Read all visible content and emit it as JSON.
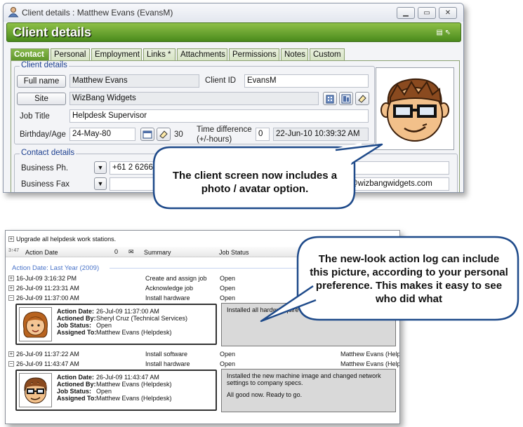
{
  "client_window": {
    "title": "Client details : Matthew Evans  (EvansM)",
    "header_title": "Client details",
    "tabs": [
      "Contact",
      "Personal",
      "Employment",
      "Links *",
      "Attachments",
      "Permissions",
      "Notes",
      "Custom"
    ],
    "client_details_group": "Client details",
    "full_name_button": "Full name",
    "full_name": "Matthew Evans",
    "client_id_label": "Client ID",
    "client_id": "EvansM",
    "site_button": "Site",
    "site": "WizBang Widgets",
    "job_title_label": "Job Title",
    "job_title": "Helpdesk Supervisor",
    "birthday_label": "Birthday/Age",
    "birthday": "24-May-80",
    "age": "30",
    "time_diff_label1": "Time difference",
    "time_diff_label2": "(+/-hours)",
    "time_diff": "0",
    "local_time": "22-Jun-10 10:39:32 AM",
    "contact_details_group": "Contact details",
    "business_ph_label": "Business Ph.",
    "business_ph": "+61 2 6266 00",
    "business_fax_label": "Business Fax",
    "email_fragment": "@wizbangwidgets.com"
  },
  "callout_top": "The client screen now includes a photo / avatar option.",
  "callout_bottom": "The new-look action log can include this picture, according to your personal preference.  This makes it easy to see who did what",
  "action_log": {
    "upgrade_row": "Upgrade all helpdesk work stations.",
    "columns": {
      "date": "Action Date",
      "summary": "Summary",
      "status": "Job Status"
    },
    "group_filter": "Action Date:    Last Year    (2009)",
    "rows": [
      {
        "date": "16-Jul-09 3:16:32 PM",
        "summary": "Create and assign job",
        "status": "Open",
        "assigned": ""
      },
      {
        "date": "26-Jul-09 11:23:31 AM",
        "summary": "Acknowledge job",
        "status": "Open",
        "assigned": ""
      },
      {
        "date": "26-Jul-09 11:37:00 AM",
        "summary": "Install hardware",
        "status": "Open",
        "assigned": ""
      },
      {
        "date": "26-Jul-09 11:37:22 AM",
        "summary": "Install software",
        "status": "Open",
        "assigned": "Matthew Evans (Help"
      },
      {
        "date": "26-Jul-09 11:43:47 AM",
        "summary": "Install hardware",
        "status": "Open",
        "assigned": "Matthew Evans (Help"
      }
    ],
    "detail1": {
      "action_date_label": "Action Date:",
      "action_date": "26-Jul-09 11:37:00 AM",
      "actioned_by_label": "Actioned By:",
      "actioned_by": "Sheryl Cruz (Technical Services)",
      "job_status_label": "Job Status:",
      "job_status": "Open",
      "assigned_to_label": "Assigned To:",
      "assigned_to": "Matthew Evans (Helpdesk)",
      "notes": "Installed all hardw          require"
    },
    "detail2": {
      "action_date_label": "Action Date:",
      "action_date": "26-Jul-09 11:43:47 AM",
      "actioned_by_label": "Actioned By:",
      "actioned_by": "Matthew Evans (Helpdesk)",
      "job_status_label": "Job Status:",
      "job_status": "Open",
      "assigned_to_label": "Assigned To:",
      "assigned_to": "Matthew Evans (Helpdesk)",
      "notes_line1": "Installed the new machine image and changed network",
      "notes_line2": "settings to company specs.",
      "notes_line3": "All good now.  Ready to go."
    }
  }
}
